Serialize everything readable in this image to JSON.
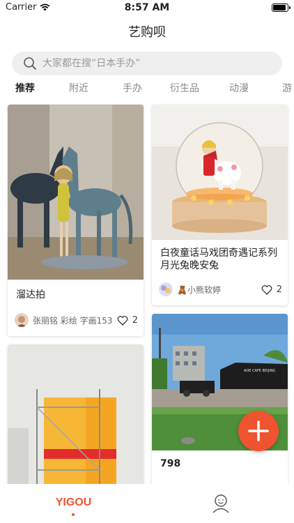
{
  "status_bar": {
    "carrier": "Carrier",
    "time": "8:57 AM",
    "battery_level": 0.95
  },
  "nav": {
    "title": "艺购呗"
  },
  "search": {
    "placeholder": "大家都在搜“日本手办”"
  },
  "tabs": [
    {
      "label": "推荐",
      "active": true
    },
    {
      "label": "附近",
      "active": false
    },
    {
      "label": "手办",
      "active": false
    },
    {
      "label": "衍生品",
      "active": false
    },
    {
      "label": "动漫",
      "active": false
    },
    {
      "label": "游",
      "active": false
    }
  ],
  "cards": [
    {
      "title": "溜达拍",
      "author": "张丽铭 彩绘 字画153",
      "likes": "2"
    },
    {
      "title": "白夜童话马戏团奇遇记系列月光兔晚安兔",
      "author": "🧸小熊软婷",
      "likes": "2"
    },
    {
      "title": "",
      "author": "",
      "likes": ""
    },
    {
      "title": "798",
      "author": "",
      "likes": ""
    }
  ],
  "photo_sign": "AOE CAFE BEIJING",
  "tabbar": {
    "home_label": "YIGOU"
  },
  "colors": {
    "accent": "#f0532f"
  }
}
